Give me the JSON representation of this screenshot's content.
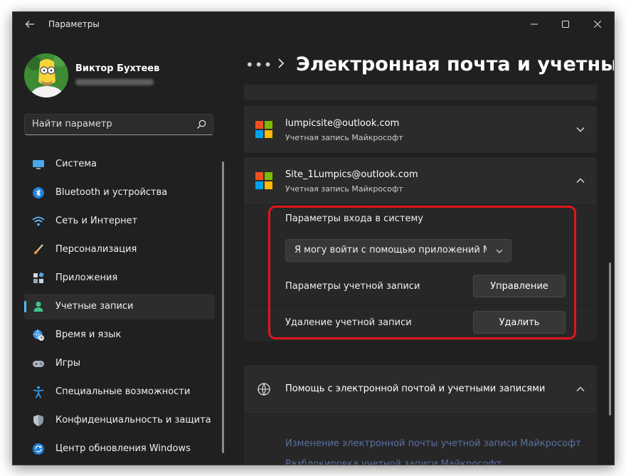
{
  "window": {
    "app_title": "Параметры",
    "back_icon": "arrow-left-icon"
  },
  "profile": {
    "name": "Виктор Бухтеев"
  },
  "search": {
    "placeholder": "Найти параметр",
    "icon": "search-icon"
  },
  "sidebar": {
    "items": [
      {
        "label": "Система",
        "icon": "monitor-icon"
      },
      {
        "label": "Bluetooth и устройства",
        "icon": "bluetooth-icon"
      },
      {
        "label": "Сеть и Интернет",
        "icon": "wifi-icon"
      },
      {
        "label": "Персонализация",
        "icon": "brush-icon"
      },
      {
        "label": "Приложения",
        "icon": "apps-icon"
      },
      {
        "label": "Учетные записи",
        "icon": "person-icon",
        "active": true
      },
      {
        "label": "Время и язык",
        "icon": "globe-clock-icon"
      },
      {
        "label": "Игры",
        "icon": "gamepad-icon"
      },
      {
        "label": "Специальные возможности",
        "icon": "accessibility-icon"
      },
      {
        "label": "Конфиденциальность и защита",
        "icon": "shield-icon"
      },
      {
        "label": "Центр обновления Windows",
        "icon": "update-icon"
      }
    ]
  },
  "header": {
    "more": "•••",
    "title": "Электронная почта и учетные записи"
  },
  "accounts": [
    {
      "email": "lumpicsite@outlook.com",
      "type": "Учетная запись Майкрософт",
      "expanded": false
    },
    {
      "email": "Site_1Lumpics@outlook.com",
      "type": "Учетная запись Майкрософт",
      "expanded": true
    }
  ],
  "account_settings": {
    "signin_label": "Параметры входа в систему",
    "signin_value": "Я могу войти с помощью приложений Майкрософт",
    "account_params_label": "Параметры учетной записи",
    "manage_button": "Управление",
    "remove_label": "Удаление учетной записи",
    "remove_button": "Удалить"
  },
  "help": {
    "title": "Помощь с электронной почтой и учетными записями",
    "links": [
      "Изменение электронной почты учетной записи Майкрософт",
      "Разблокировка учетной записи Майкрософт"
    ]
  },
  "colors": {
    "accent": "#4cc2ff",
    "highlight": "#e0161b",
    "ms_red": "#f25022",
    "ms_green": "#7fba00",
    "ms_blue": "#00a4ef",
    "ms_yellow": "#ffb900"
  }
}
